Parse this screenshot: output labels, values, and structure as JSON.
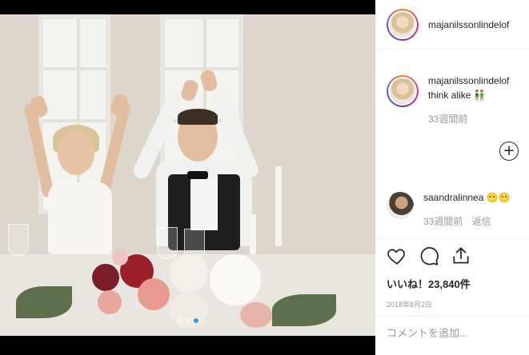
{
  "post": {
    "username": "majanilssonlindelof",
    "caption": {
      "username": "majanilssonlindelof",
      "text": "think alike 👬",
      "time": "33週間前"
    },
    "comments": [
      {
        "username": "saandralinnea",
        "text": "😶😶",
        "time": "33週間前",
        "reply_label": "返信"
      }
    ],
    "likes_text": "いいね！23,840件",
    "date": "2018年8月2日",
    "add_comment_placeholder": "コメントを追加...",
    "carousel": {
      "count": 3,
      "active": 3
    }
  },
  "icons": {
    "like": "heart-icon",
    "comment": "comment-bubble-icon",
    "share": "share-icon",
    "load_more": "plus-circle-icon"
  },
  "colors": {
    "accent": "#3897f0",
    "text": "#262626",
    "muted": "#999999"
  }
}
